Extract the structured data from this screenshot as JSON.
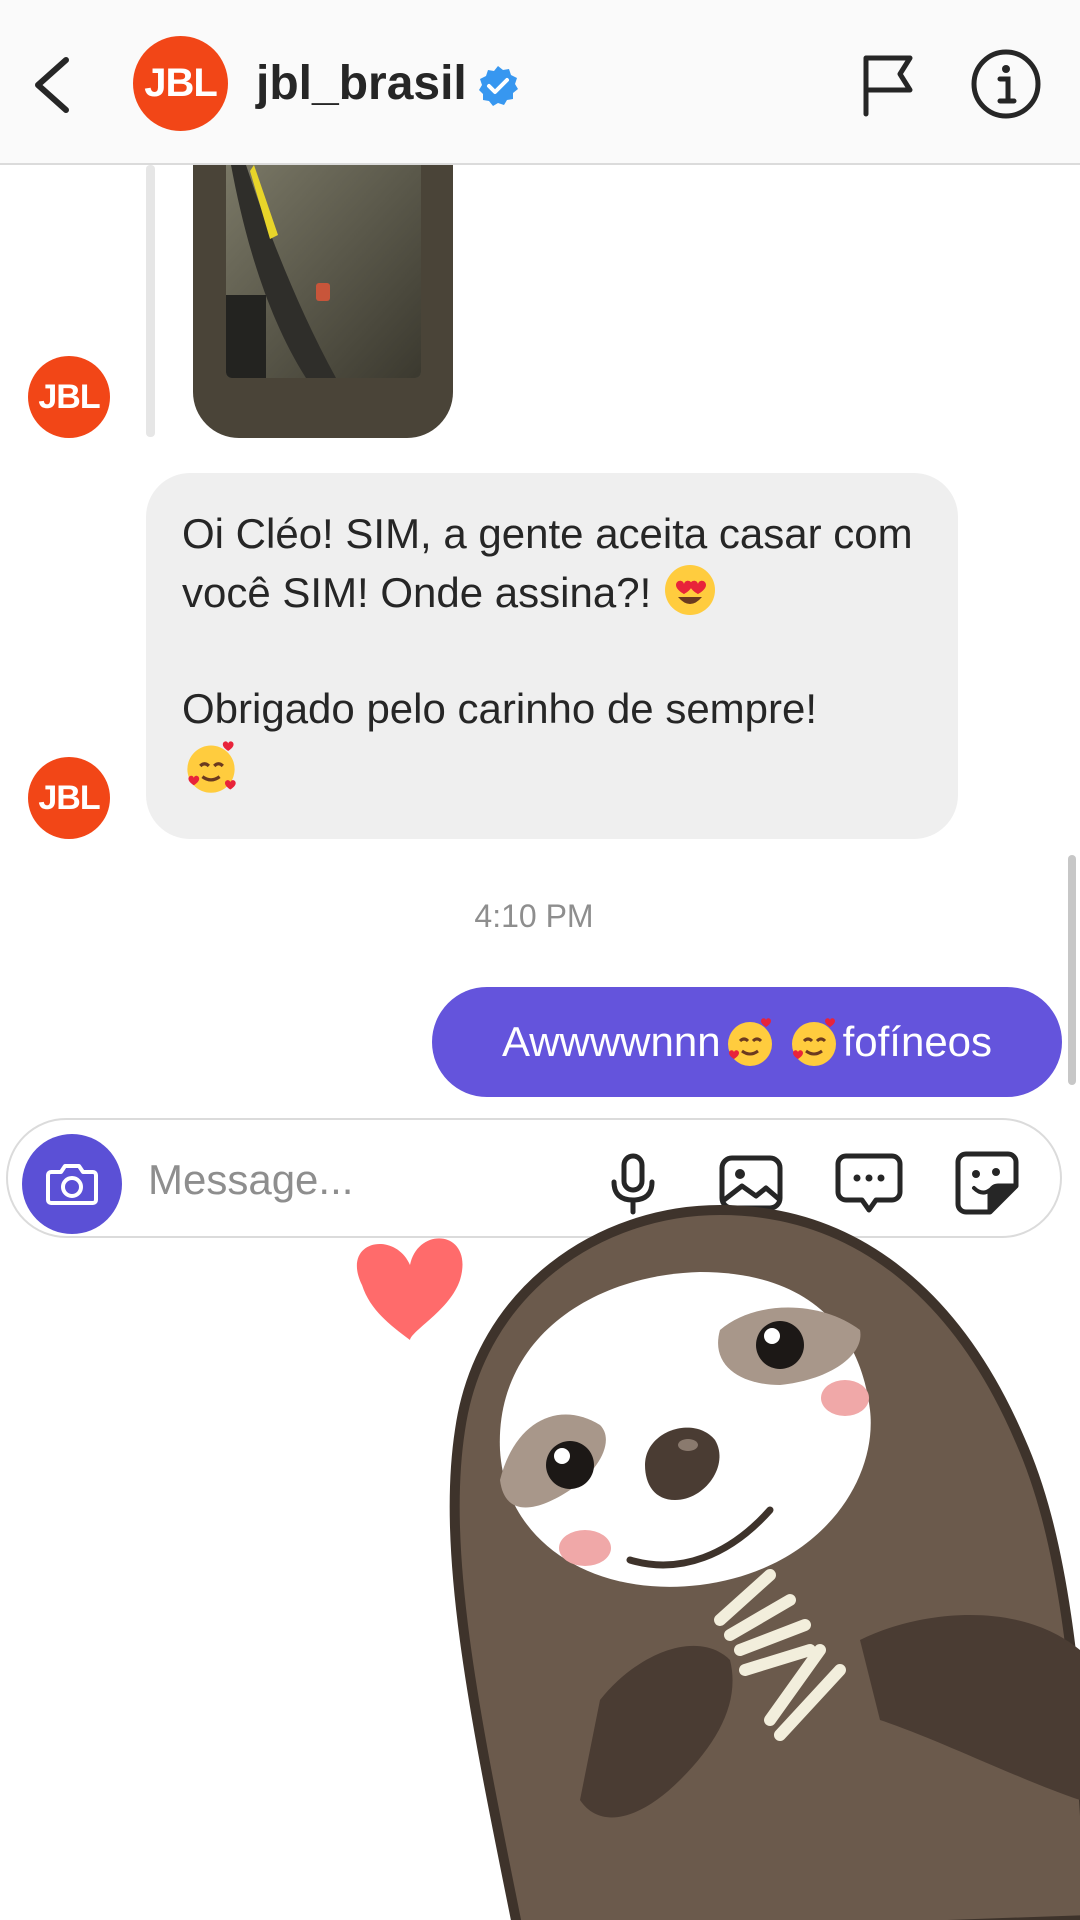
{
  "header": {
    "back_icon": "chevron-left-icon",
    "avatar_text": "JBL",
    "username": "jbl_brasil",
    "verified_icon": "verified-badge-icon",
    "flag_icon": "flag-icon",
    "info_icon": "info-icon"
  },
  "thread": {
    "avatar_text": "JBL",
    "received_message": {
      "line1": "Oi Cléo! SIM, a gente aceita casar com você SIM! Onde assina?!",
      "line1_emoji": "heart-eyes-emoji",
      "line2": "Obrigado pelo carinho de sempre!",
      "line2_emoji": "smiling-face-with-hearts-emoji"
    },
    "timestamp": "4:10 PM",
    "sent_message": {
      "prefix": "Awwwwnnn",
      "emojis": [
        "smiling-face-with-hearts-emoji",
        "smiling-face-with-hearts-emoji"
      ],
      "suffix": "fofíneos"
    }
  },
  "composer": {
    "placeholder": "Message...",
    "camera_icon": "camera-icon",
    "mic_icon": "microphone-icon",
    "gallery_icon": "gallery-icon",
    "chat_icon": "chat-bubble-icon",
    "sticker_icon": "sticker-icon"
  },
  "sticker": {
    "icon": "sloth-heart-sticker"
  },
  "colors": {
    "brand": "#f24617",
    "sent_bubble": "#6454dc",
    "received_bubble": "#efefef",
    "verified": "#3797f0"
  }
}
